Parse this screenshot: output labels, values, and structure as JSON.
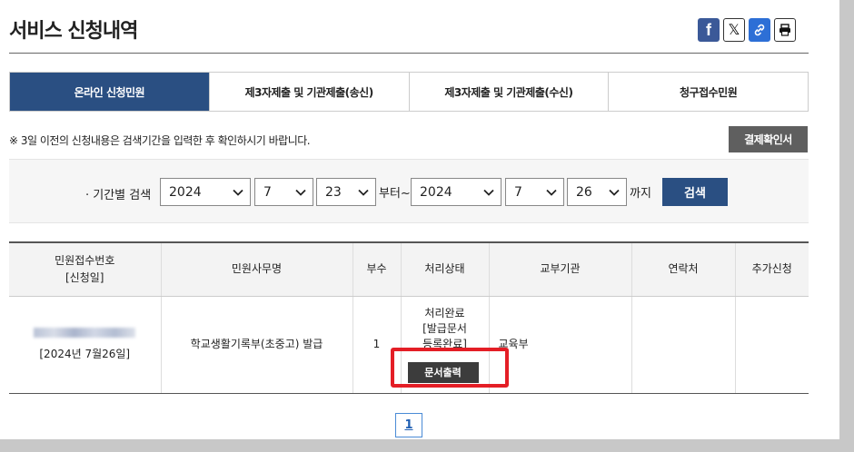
{
  "header": {
    "title": "서비스 신청내역"
  },
  "share": {
    "facebook_glyph": "f",
    "x_glyph": "𝕏"
  },
  "tabs": [
    {
      "label": "온라인 신청민원",
      "active": true
    },
    {
      "label": "제3자제출 및 기관제출(송신)",
      "active": false
    },
    {
      "label": "제3자제출 및 기관제출(수신)",
      "active": false
    },
    {
      "label": "청구접수민원",
      "active": false
    }
  ],
  "notice": "※ 3일 이전의 신청내용은 검색기간을 입력한 후 확인하시기 바랍니다.",
  "confirm_button": "결제확인서",
  "search": {
    "label": "· 기간별 검색",
    "from": {
      "year": "2024",
      "month": "7",
      "day": "23"
    },
    "from_suffix": "부터~",
    "to": {
      "year": "2024",
      "month": "7",
      "day": "26"
    },
    "to_suffix": "까지",
    "button": "검색"
  },
  "table": {
    "headers": [
      "민원접수번호",
      "[신청일]",
      "민원사무명",
      "부수",
      "처리상태",
      "교부기관",
      "연락처",
      "추가신청"
    ],
    "rows": [
      {
        "receipt_date": "[2024년 7월26일]",
        "service_name": "학교생활기록부(초중고) 발급",
        "copies": "1",
        "status": "처리완료",
        "status_line2": "[발급문서",
        "status_line3": "등록완료]",
        "print_button": "문서출력",
        "issuing_org": "교육부",
        "contact": "",
        "additional": ""
      }
    ]
  },
  "pagination": {
    "current": "1"
  },
  "colors": {
    "primary": "#2a4f82",
    "highlight": "#e41e26",
    "dark_button": "#5f5f5f"
  }
}
